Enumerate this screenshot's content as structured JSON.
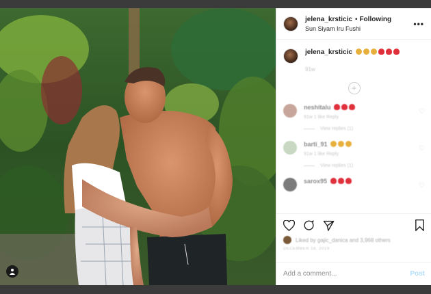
{
  "post": {
    "username": "jelena_krsticic",
    "dot": "•",
    "following": "Following",
    "location": "Sun Siyam Iru Fushi",
    "more": "•••"
  },
  "caption": {
    "username": "jelena_krsticic",
    "time": "91w"
  },
  "load_more": "+",
  "comments": [
    {
      "username": "neshitalu",
      "meta": "91w  1 like  Reply",
      "replies": "View replies (1)",
      "avatar_color": "#c7a59a"
    },
    {
      "username": "barti_91",
      "meta": "91w  1 like  Reply",
      "replies": "View replies (1)",
      "avatar_color": "#c9d8c2"
    },
    {
      "username": "sarox95",
      "meta": "",
      "replies": "",
      "avatar_color": "#7b7b7b"
    }
  ],
  "actions": {
    "liked_by": "Liked by gajic_danica and 3,968 others",
    "date": "DECEMBER 18, 2019"
  },
  "add_comment": {
    "placeholder": "Add a comment...",
    "post_label": "Post"
  },
  "colors": {
    "link_disabled": "#b2dffc",
    "text": "#262626",
    "muted": "#8e8e8e"
  }
}
